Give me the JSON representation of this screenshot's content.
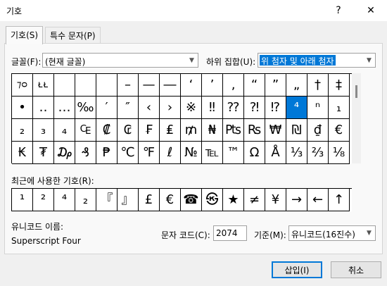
{
  "window": {
    "title": "기호",
    "help_label": "?",
    "close_label": "✕"
  },
  "tabs": [
    {
      "label": "기호(S)"
    },
    {
      "label": "특수 문자(P)"
    }
  ],
  "font": {
    "label": "글꼴(F):",
    "value": "(현재 글꼴)"
  },
  "subset": {
    "label": "하위 집합(U):",
    "value": "위 첨자 및 아래 첨자"
  },
  "symbols": [
    [
      "⁊ᴑ",
      "ᴌᴌ",
      "",
      "",
      "",
      "–",
      "—",
      "―",
      "‘",
      "’",
      "‚",
      "“",
      "”",
      "„",
      "†",
      "‡"
    ],
    [
      "•",
      "‥",
      "…",
      "‰",
      "′",
      "″",
      "‹",
      "›",
      "※",
      "‼",
      "⁇",
      "⁈",
      "⁉",
      "⁴",
      "ⁿ",
      "₁"
    ],
    [
      "₂",
      "₃",
      "₄",
      "₠",
      "₡",
      "₢",
      "₣",
      "₤",
      "₥",
      "₦",
      "₧",
      "₨",
      "₩",
      "₪",
      "₫",
      "€"
    ],
    [
      "₭",
      "₮",
      "₯",
      "₰",
      "₱",
      "℃",
      "℉",
      "ℓ",
      "№",
      "℡",
      "™",
      "Ω",
      "Å",
      "⅓",
      "⅔",
      "⅛"
    ]
  ],
  "selected_symbol": "⁴",
  "recent": {
    "label": "최근에 사용한 기호(R):",
    "items": [
      "¹",
      "²",
      "⁴",
      "₂",
      "『",
      "』",
      "£",
      "€",
      "☎",
      "㉿",
      "★",
      "≠",
      "¥",
      "→",
      "←",
      "↑"
    ]
  },
  "unicode_name": {
    "label": "유니코드 이름:",
    "value": "Superscript Four"
  },
  "char_code": {
    "label": "문자 코드(C):",
    "value": "2074"
  },
  "from": {
    "label": "기준(M):",
    "value": "유니코드(16진수)"
  },
  "buttons": {
    "insert": "삽입(I)",
    "cancel": "취소"
  },
  "colors": {
    "accent": "#0078d7",
    "dialog_bg": "#f0f0f0"
  }
}
